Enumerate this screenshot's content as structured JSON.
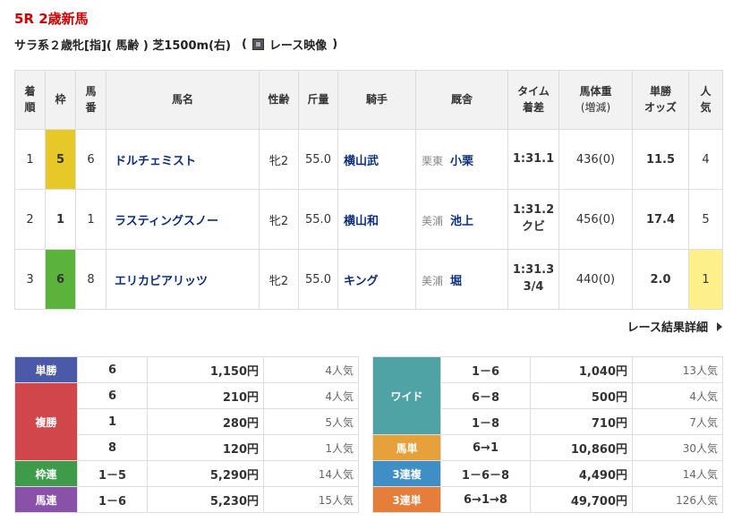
{
  "race": {
    "title": "5R 2歳新馬",
    "conditions": "サラ系２歳牝[指]( 馬齢 ) 芝1500m(右)",
    "paren_open": "(",
    "video_label": "レース映像",
    "paren_close": ")"
  },
  "results_header": {
    "rank": [
      "着",
      "順"
    ],
    "waku": "枠",
    "umaban": [
      "馬",
      "番"
    ],
    "name": "馬名",
    "sex_age": "性齢",
    "weight": "斤量",
    "jockey": "騎手",
    "trainer": "厩舎",
    "time": [
      "タイム",
      "着差"
    ],
    "body_weight": [
      "馬体重",
      "(増減)"
    ],
    "odds": [
      "単勝",
      "オッズ"
    ],
    "popularity": [
      "人",
      "気"
    ]
  },
  "results": [
    {
      "rank": "1",
      "waku": "5",
      "waku_color": "#e6c829",
      "umaban": "6",
      "name": "ドルチェミスト",
      "sex_age": "牝2",
      "weight": "55.0",
      "jockey": "横山武",
      "trainer_area": "栗東",
      "trainer": "小栗",
      "time": "1:31.1",
      "margin": "",
      "body_weight": "436(0)",
      "odds": "11.5",
      "popularity": "4"
    },
    {
      "rank": "2",
      "waku": "1",
      "waku_color": "#ffffff",
      "umaban": "1",
      "name": "ラスティングスノー",
      "sex_age": "牝2",
      "weight": "55.0",
      "jockey": "横山和",
      "trainer_area": "美浦",
      "trainer": "池上",
      "time": "1:31.2",
      "margin": "クビ",
      "body_weight": "456(0)",
      "odds": "17.4",
      "popularity": "5"
    },
    {
      "rank": "3",
      "waku": "6",
      "waku_color": "#5cb33c",
      "umaban": "8",
      "name": "エリカビアリッツ",
      "sex_age": "牝2",
      "weight": "55.0",
      "jockey": "キング",
      "trainer_area": "美浦",
      "trainer": "堀",
      "time": "1:31.3",
      "margin": "3/4",
      "body_weight": "440(0)",
      "odds": "2.0",
      "popularity": "1",
      "popularity_highlight": "#fdf08a"
    }
  ],
  "detail_link": "レース結果詳細",
  "payouts_left": [
    {
      "type": "単勝",
      "color": "#4b5aa8",
      "rows": [
        {
          "combo": "6",
          "amount": "1,150円",
          "pop": "4人気"
        }
      ]
    },
    {
      "type": "複勝",
      "color": "#d0464b",
      "rows": [
        {
          "combo": "6",
          "amount": "210円",
          "pop": "4人気"
        },
        {
          "combo": "1",
          "amount": "280円",
          "pop": "5人気"
        },
        {
          "combo": "8",
          "amount": "120円",
          "pop": "1人気"
        }
      ]
    },
    {
      "type": "枠連",
      "color": "#3e9b49",
      "rows": [
        {
          "combo": "1－5",
          "amount": "5,290円",
          "pop": "14人気"
        }
      ]
    },
    {
      "type": "馬連",
      "color": "#8a51a8",
      "rows": [
        {
          "combo": "1－6",
          "amount": "5,230円",
          "pop": "15人気"
        }
      ]
    }
  ],
  "payouts_right": [
    {
      "type": "ワイド",
      "color": "#4fa3a5",
      "rows": [
        {
          "combo": "1－6",
          "amount": "1,040円",
          "pop": "13人気"
        },
        {
          "combo": "6－8",
          "amount": "500円",
          "pop": "4人気"
        },
        {
          "combo": "1－8",
          "amount": "710円",
          "pop": "7人気"
        }
      ]
    },
    {
      "type": "馬単",
      "color": "#e6a13a",
      "rows": [
        {
          "combo": "6→1",
          "amount": "10,860円",
          "pop": "30人気"
        }
      ]
    },
    {
      "type": "3連複",
      "color": "#3f8fc6",
      "rows": [
        {
          "combo": "1－6－8",
          "amount": "4,490円",
          "pop": "14人気"
        }
      ]
    },
    {
      "type": "3連単",
      "color": "#e47e3a",
      "rows": [
        {
          "combo": "6→1→8",
          "amount": "49,700円",
          "pop": "126人気"
        }
      ]
    }
  ]
}
